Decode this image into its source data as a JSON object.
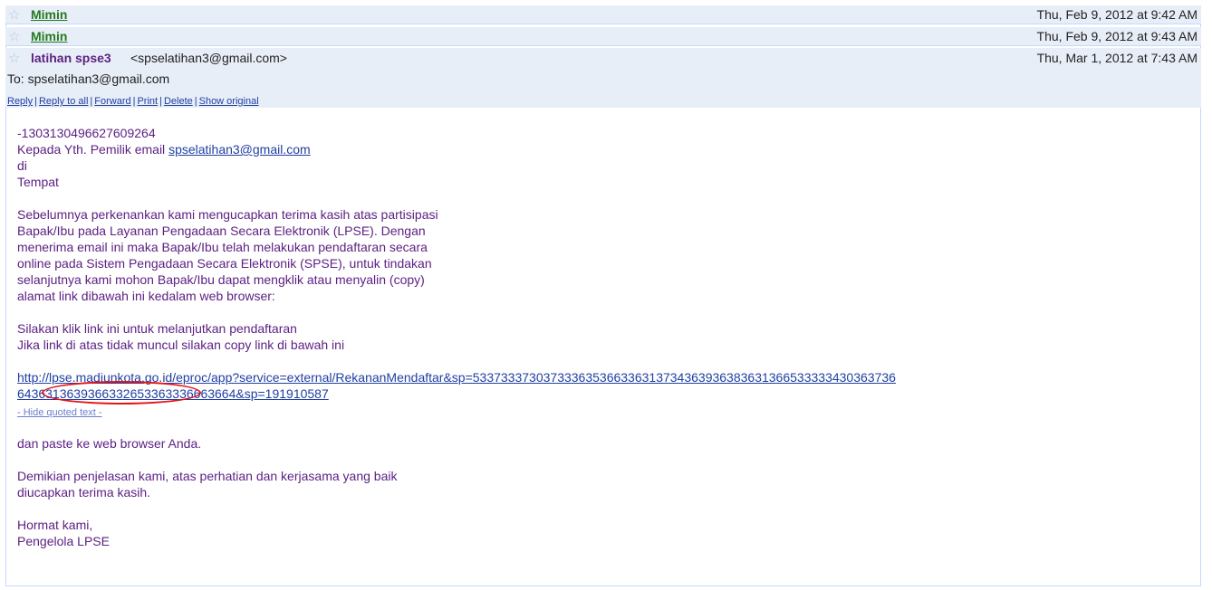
{
  "thread": [
    {
      "sender": "Mimin",
      "date": "Thu, Feb 9, 2012 at 9:42 AM"
    },
    {
      "sender": "Mimin",
      "date": "Thu, Feb 9, 2012 at 9:43 AM"
    }
  ],
  "message": {
    "sender_name": "latihan spse3",
    "sender_email": "<spselatihan3@gmail.com>",
    "date": "Thu, Mar 1, 2012 at 7:43 AM",
    "to": "To: spselatihan3@gmail.com",
    "actions": [
      "Reply",
      "Reply to all",
      "Forward",
      "Print",
      "Delete",
      "Show original"
    ],
    "body": {
      "code": "-1303130496627609264",
      "greeting_prefix": "Kepada Yth. Pemilik email ",
      "greeting_email": "spselatihan3@gmail.com",
      "di": "di",
      "tempat": "Tempat",
      "para1": [
        "Sebelumnya perkenankan kami mengucapkan terima kasih atas partisipasi",
        "Bapak/Ibu pada Layanan Pengadaan Secara Elektronik (LPSE). Dengan",
        "menerima email ini maka Bapak/Ibu telah melakukan pendaftaran secara",
        "online pada Sistem Pengadaan Secara Elektronik (SPSE), untuk tindakan",
        "selanjutnya kami mohon Bapak/Ibu dapat mengklik atau menyalin (copy)",
        "alamat link dibawah ini kedalam web browser:"
      ],
      "para2": [
        "Silakan klik link ini untuk melanjutkan pendaftaran",
        "Jika link di atas tidak muncul silakan copy link di bawah ini"
      ],
      "link_line1": "http://lpse.madiunkota.go.id/eproc/app?service=external/RekananMendaftar&sp=53373337303733363536633631373436393638363136653333343036373​6",
      "link_line2": "6436313639366332653363336663664&sp=191910587",
      "hide_quoted": "- Hide quoted text -",
      "paste": "dan paste ke web browser Anda.",
      "para3": [
        "Demikian penjelasan kami, atas perhatian dan kerjasama yang baik",
        "diucapkan terima kasih."
      ],
      "closing": [
        "Hormat kami,",
        "Pengelola LPSE"
      ]
    }
  },
  "colors": {
    "header_bg": "#e8eef7",
    "sender_green": "#247a20",
    "body_purple": "#5d2183",
    "link_blue": "#1f3fa3",
    "highlight_red": "#e0141b"
  }
}
